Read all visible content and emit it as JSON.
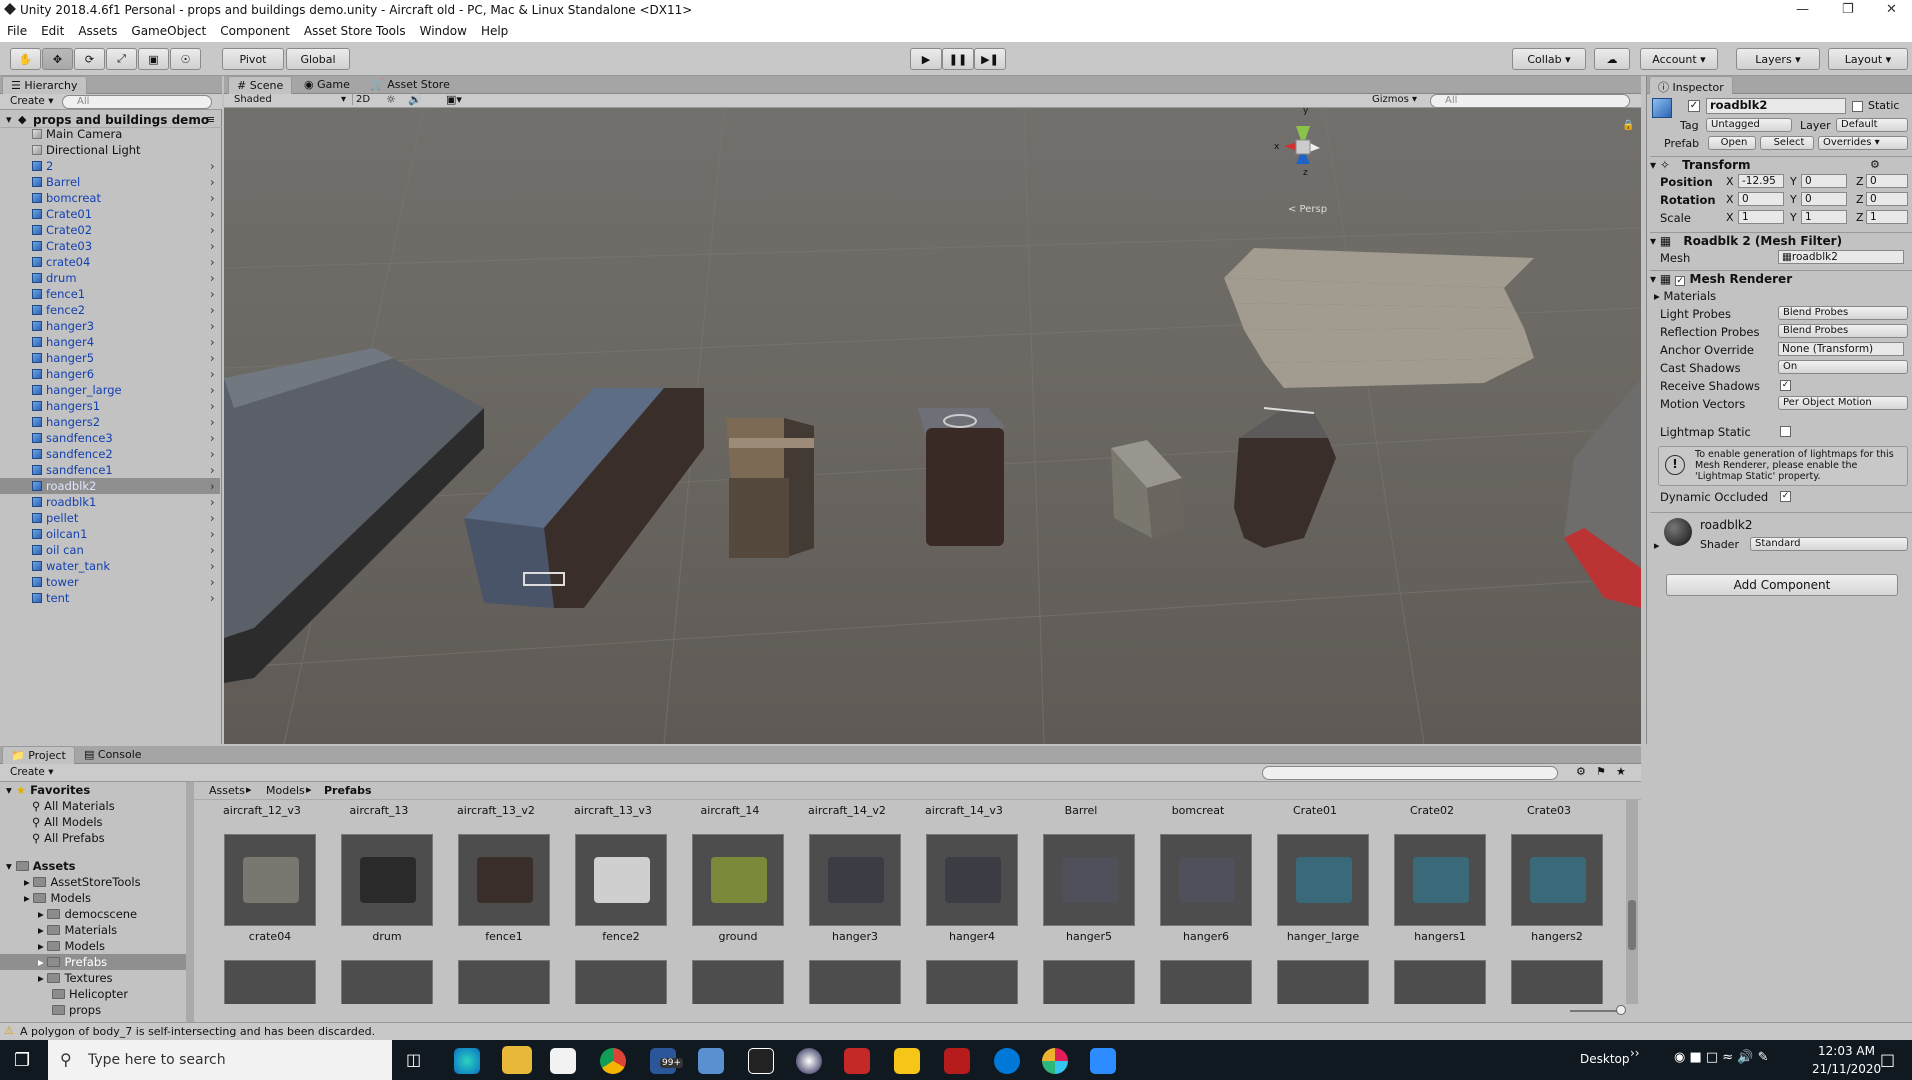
{
  "window": {
    "title": "Unity 2018.4.6f1 Personal - props and buildings demo.unity - Aircraft old - PC, Mac & Linux Standalone <DX11>"
  },
  "menu": [
    "File",
    "Edit",
    "Assets",
    "GameObject",
    "Component",
    "Asset Store Tools",
    "Window",
    "Help"
  ],
  "toolbar": {
    "pivot": "Pivot",
    "global": "Global",
    "collab": "Collab",
    "account": "Account",
    "layers": "Layers",
    "layout": "Layout"
  },
  "hierarchy": {
    "tab": "Hierarchy",
    "create": "Create",
    "search_placeholder": "All",
    "scene": "props and buildings demo",
    "items": [
      {
        "name": "Main Camera",
        "kind": "plain"
      },
      {
        "name": "Directional Light",
        "kind": "plain"
      },
      {
        "name": "2",
        "kind": "prefab"
      },
      {
        "name": "Barrel",
        "kind": "prefab"
      },
      {
        "name": "bomcreat",
        "kind": "prefab"
      },
      {
        "name": "Crate01",
        "kind": "prefab"
      },
      {
        "name": "Crate02",
        "kind": "prefab"
      },
      {
        "name": "Crate03",
        "kind": "prefab"
      },
      {
        "name": "crate04",
        "kind": "prefab"
      },
      {
        "name": "drum",
        "kind": "prefab"
      },
      {
        "name": "fence1",
        "kind": "prefab"
      },
      {
        "name": "fence2",
        "kind": "prefab"
      },
      {
        "name": "hanger3",
        "kind": "prefab"
      },
      {
        "name": "hanger4",
        "kind": "prefab"
      },
      {
        "name": "hanger5",
        "kind": "prefab"
      },
      {
        "name": "hanger6",
        "kind": "prefab"
      },
      {
        "name": "hanger_large",
        "kind": "prefab"
      },
      {
        "name": "hangers1",
        "kind": "prefab"
      },
      {
        "name": "hangers2",
        "kind": "prefab"
      },
      {
        "name": "sandfence3",
        "kind": "prefab"
      },
      {
        "name": "sandfence2",
        "kind": "prefab"
      },
      {
        "name": "sandfence1",
        "kind": "prefab"
      },
      {
        "name": "roadblk2",
        "kind": "selected"
      },
      {
        "name": "roadblk1",
        "kind": "prefab"
      },
      {
        "name": "pellet",
        "kind": "prefab"
      },
      {
        "name": "oilcan1",
        "kind": "prefab"
      },
      {
        "name": "oil can",
        "kind": "prefab"
      },
      {
        "name": "water_tank",
        "kind": "prefab"
      },
      {
        "name": "tower",
        "kind": "prefab"
      },
      {
        "name": "tent",
        "kind": "prefab"
      }
    ]
  },
  "scene_view": {
    "tabs": [
      "Scene",
      "Game",
      "Asset Store"
    ],
    "shading": "Shaded",
    "mode_2d": "2D",
    "gizmos": "Gizmos",
    "search_placeholder": "All",
    "persp": "< Persp",
    "axes": {
      "x": "x",
      "y": "y",
      "z": "z"
    }
  },
  "inspector": {
    "tab": "Inspector",
    "object_name": "roadblk2",
    "static_label": "Static",
    "tag_label": "Tag",
    "tag_value": "Untagged",
    "layer_label": "Layer",
    "layer_value": "Default",
    "prefab_label": "Prefab",
    "open": "Open",
    "select": "Select",
    "overrides": "Overrides",
    "transform": {
      "title": "Transform",
      "position_label": "Position",
      "position": {
        "x": "-12.95",
        "y": "0",
        "z": "0"
      },
      "rotation_label": "Rotation",
      "rotation": {
        "x": "0",
        "y": "0",
        "z": "0"
      },
      "scale_label": "Scale",
      "scale": {
        "x": "1",
        "y": "1",
        "z": "1"
      }
    },
    "mesh_filter": {
      "title": "Roadblk 2 (Mesh Filter)",
      "mesh_label": "Mesh",
      "mesh_value": "roadblk2"
    },
    "mesh_renderer": {
      "title": "Mesh Renderer",
      "materials": "Materials",
      "light_probes_label": "Light Probes",
      "light_probes": "Blend Probes",
      "reflection_label": "Reflection Probes",
      "reflection": "Blend Probes",
      "anchor_label": "Anchor Override",
      "anchor": "None (Transform)",
      "cast_label": "Cast Shadows",
      "cast": "On",
      "receive_label": "Receive Shadows",
      "motion_label": "Motion Vectors",
      "motion": "Per Object Motion",
      "lightmap_label": "Lightmap Static",
      "info": "To enable generation of lightmaps for this Mesh Renderer, please enable the 'Lightmap Static' property.",
      "occluded_label": "Dynamic Occluded"
    },
    "material": {
      "name": "roadblk2",
      "shader_label": "Shader",
      "shader": "Standard"
    },
    "add_component": "Add Component"
  },
  "project": {
    "tabs": [
      "Project",
      "Console"
    ],
    "create": "Create",
    "favorites": "Favorites",
    "fav_items": [
      "All Materials",
      "All Models",
      "All Prefabs"
    ],
    "assets": "Assets",
    "tree": [
      {
        "name": "AssetStoreTools",
        "depth": 1
      },
      {
        "name": "Models",
        "depth": 1
      },
      {
        "name": "democscene",
        "depth": 2
      },
      {
        "name": "Materials",
        "depth": 2
      },
      {
        "name": "Models",
        "depth": 2
      },
      {
        "name": "Prefabs",
        "depth": 2,
        "selected": true
      },
      {
        "name": "Textures",
        "depth": 2
      },
      {
        "name": "Helicopter",
        "depth": 3
      },
      {
        "name": "props",
        "depth": 3
      }
    ],
    "breadcrumb": [
      "Assets",
      "Models",
      "Prefabs"
    ],
    "top_labels": [
      "aircraft_12_v3",
      "aircraft_13",
      "aircraft_13_v2",
      "aircraft_13_v3",
      "aircraft_14",
      "aircraft_14_v2",
      "aircraft_14_v3",
      "Barrel",
      "bomcreat",
      "Crate01",
      "Crate02",
      "Crate03"
    ],
    "row_labels": [
      "crate04",
      "drum",
      "fence1",
      "fence2",
      "ground",
      "hanger3",
      "hanger4",
      "hanger5",
      "hanger6",
      "hanger_large",
      "hangers1",
      "hangers2"
    ]
  },
  "status": {
    "message": "A polygon of body_7 is self-intersecting and has been discarded."
  },
  "taskbar": {
    "search_placeholder": "Type here to search",
    "desktop": "Desktop",
    "time": "12:03 AM",
    "date": "21/11/2020",
    "mail_badge": "99+"
  }
}
